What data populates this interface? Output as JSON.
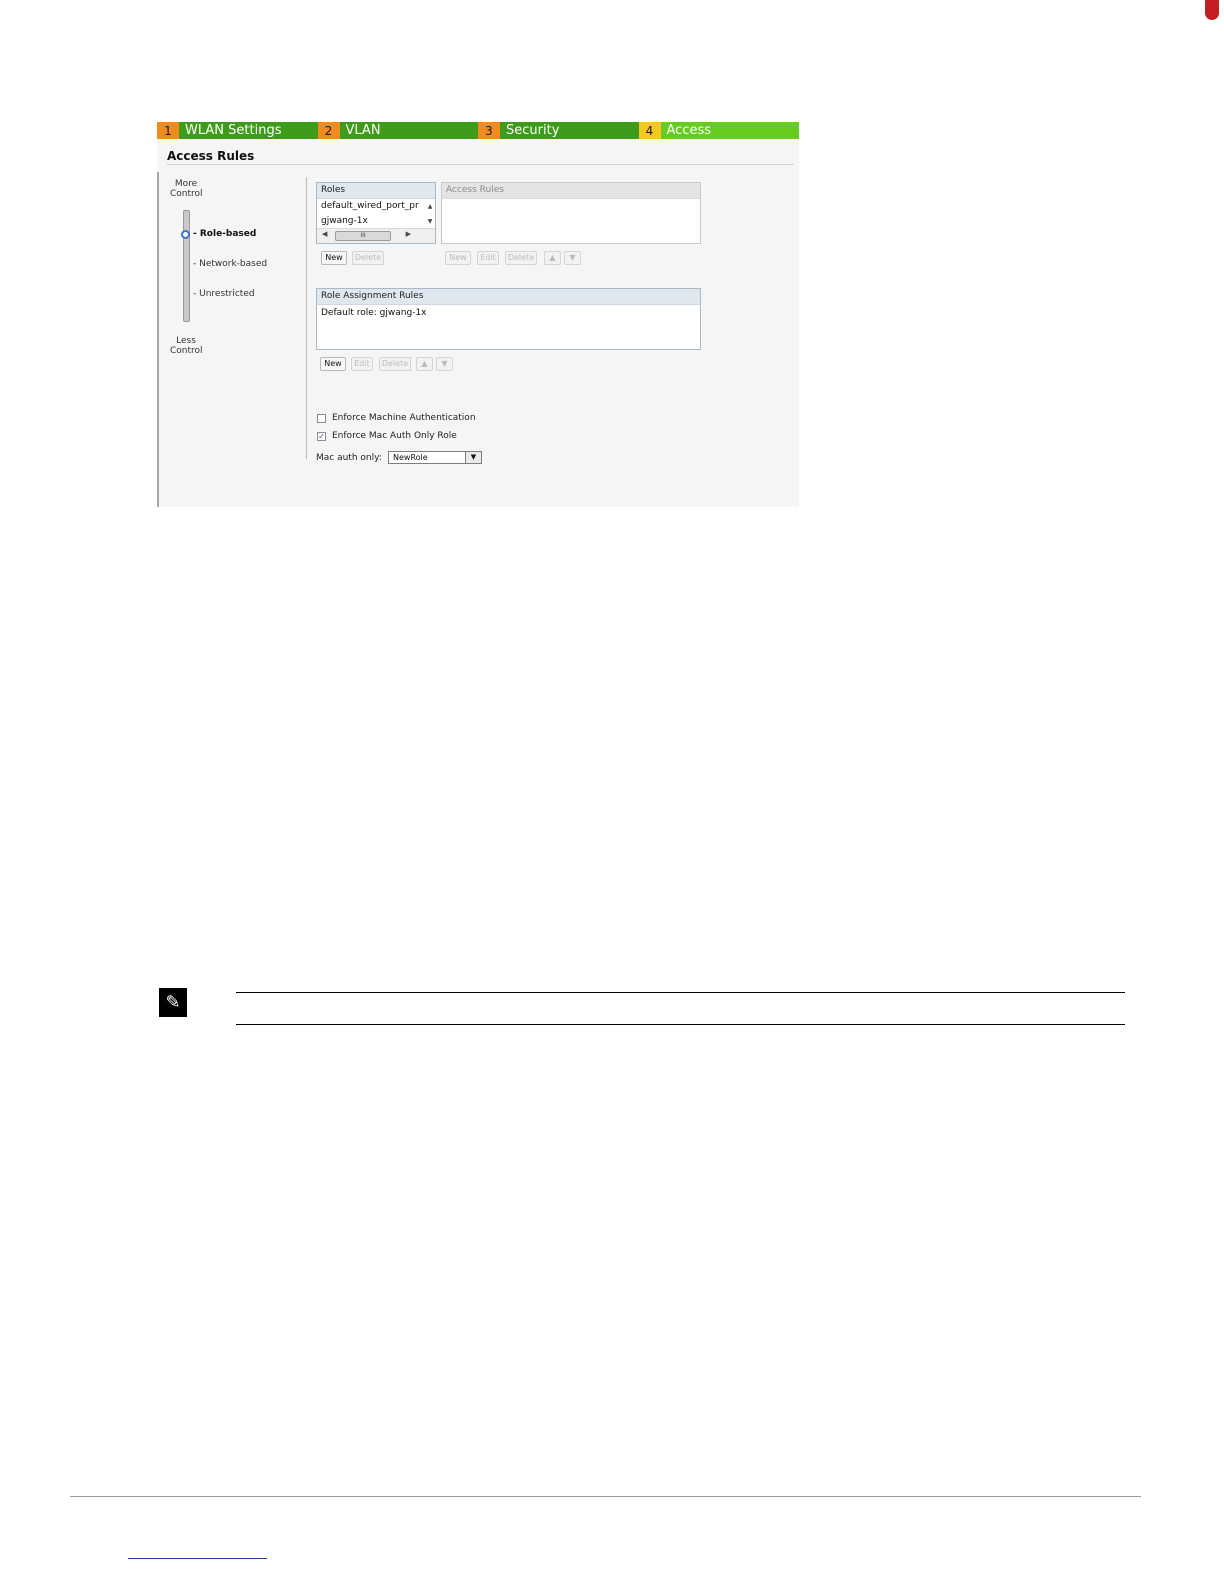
{
  "wizard": {
    "tabs": [
      {
        "number": "1",
        "label": "WLAN Settings"
      },
      {
        "number": "2",
        "label": "VLAN"
      },
      {
        "number": "3",
        "label": "Security"
      },
      {
        "number": "4",
        "label": "Access"
      }
    ],
    "active_tab": "4"
  },
  "access_rules": {
    "title": "Access Rules",
    "slider": {
      "top_label": "More\nControl",
      "bottom_label": "Less\nControl",
      "options": [
        "- Role-based",
        "- Network-based",
        "- Unrestricted"
      ],
      "selected": "- Role-based"
    },
    "roles": {
      "header": "Roles",
      "items": [
        "default_wired_port_pr",
        "gjwang-1x"
      ],
      "scroll_thumb": "III",
      "new_label": "New",
      "delete_label": "Delete"
    },
    "rules": {
      "header": "Access Rules",
      "new_label": "New",
      "edit_label": "Edit",
      "delete_label": "Delete"
    },
    "role_assignment": {
      "header": "Role Assignment Rules",
      "default_text": "Default role: gjwang-1x",
      "new_label": "New",
      "edit_label": "Edit",
      "delete_label": "Delete"
    },
    "enforce_machine_auth": {
      "label": "Enforce Machine Authentication",
      "checked": false
    },
    "enforce_mac_auth": {
      "label": "Enforce Mac Auth Only Role",
      "checked": true
    },
    "mac_auth_only": {
      "label": "Mac auth only:",
      "value": "NewRole"
    }
  },
  "colors": {
    "tab_green": "#3f9b1a",
    "tab_active_green": "#66cc1e",
    "tab_number_orange": "#f08b1e",
    "tab_active_number": "#f5c81e",
    "slider_thumb": "#3b73c8"
  },
  "icons": {
    "note": "pencil-note-icon",
    "arrow_up": "arrow-up-icon",
    "arrow_down": "arrow-down-icon"
  }
}
